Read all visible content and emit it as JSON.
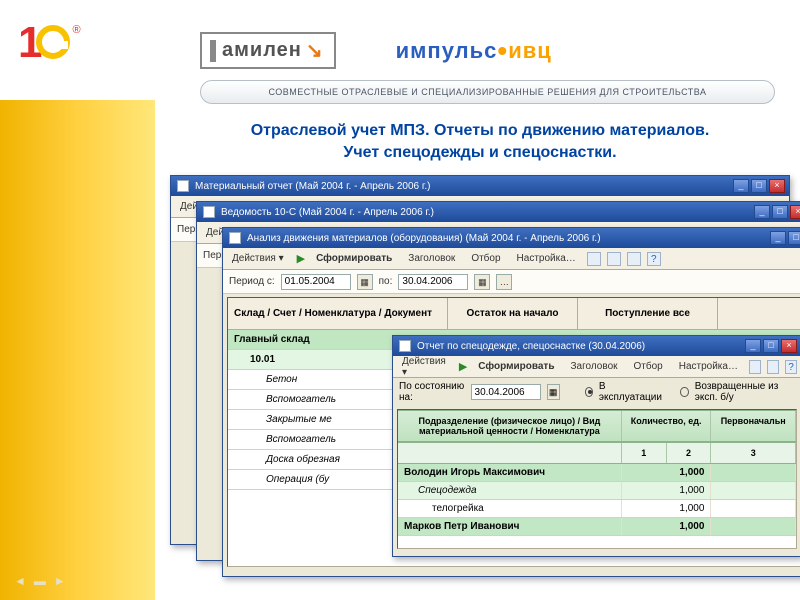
{
  "logos": {
    "amilen": "амилен",
    "impuls_blue": "импульс",
    "impuls_orange": "ивц"
  },
  "ribbon": "СОВМЕСТНЫЕ ОТРАСЛЕВЫЕ И СПЕЦИАЛИЗИРОВАННЫЕ РЕШЕНИЯ ДЛЯ СТРОИТЕЛЬСТВА",
  "slide_title_line1": "Отраслевой учет МПЗ. Отчеты по движению материалов.",
  "slide_title_line2": "Учет спецодежды и спецоснастки.",
  "toolbar_labels": {
    "actions": "Действия ▾",
    "run": "Сформировать",
    "header": "Заголовок",
    "filter": "Отбор",
    "settings": "Настройка…"
  },
  "period_label": "Период с:",
  "po_label": "по:",
  "sost_label": "По состоянию на:",
  "win1": {
    "title": "Материальный отчет (Май 2004 г. - Апрель 2006 г.)"
  },
  "win2": {
    "title": "Ведомость 10-С (Май 2004 г. - Апрель 2006 г.)"
  },
  "win3": {
    "title": "Анализ движения материалов (оборудования) (Май 2004 г. - Апрель 2006 г.)",
    "date_from": "01.05.2004",
    "date_to": "30.04.2006",
    "headers": {
      "nom": "Склад / Счет / Номенклатура / Документ",
      "ost": "Остаток на начало",
      "post": "Поступление все"
    },
    "rows": [
      {
        "cls": "green",
        "text": "Главный склад"
      },
      {
        "cls": "lightgreen",
        "text": "10.01",
        "indent": 1
      },
      {
        "cls": "",
        "text": "Бетон",
        "ital": true,
        "indent": 2
      },
      {
        "cls": "",
        "text": "Вспомогатель",
        "ital": true,
        "indent": 2
      },
      {
        "cls": "",
        "text": "Закрытые ме",
        "ital": true,
        "indent": 2
      },
      {
        "cls": "",
        "text": "Вспомогатель",
        "ital": true,
        "indent": 2
      },
      {
        "cls": "",
        "text": "Доска обрезная",
        "ital": true,
        "indent": 2
      },
      {
        "cls": "",
        "text": "Операция (бу",
        "ital": true,
        "indent": 2
      }
    ]
  },
  "win4": {
    "title": "Отчет по спецодежде, спецоснастке (30.04.2006)",
    "date": "30.04.2006",
    "radio1": "В эксплуатации",
    "radio2": "Возвращенные из эксп. б/у",
    "headers": {
      "a": "Подразделение (физическое лицо) / Вид материальной ценности / Номенклатура",
      "b": "Количество, ед.",
      "c": "Первоначальн"
    },
    "subhead": {
      "b1": "1",
      "b2": "2",
      "c": "3"
    },
    "rows": [
      {
        "cls": "greenrow bold",
        "a": "Володин Игорь Максимович",
        "b": "1,000",
        "c": ""
      },
      {
        "cls": "lgreenrow",
        "a": "Спецодежда",
        "b": "1,000",
        "c": "",
        "ital": true,
        "indent": 1
      },
      {
        "cls": "",
        "a": "телогрейка",
        "b": "1,000",
        "c": "",
        "indent": 2
      },
      {
        "cls": "greenrow bold",
        "a": "Марков Петр Иванович",
        "b": "1,000",
        "c": ""
      }
    ]
  }
}
